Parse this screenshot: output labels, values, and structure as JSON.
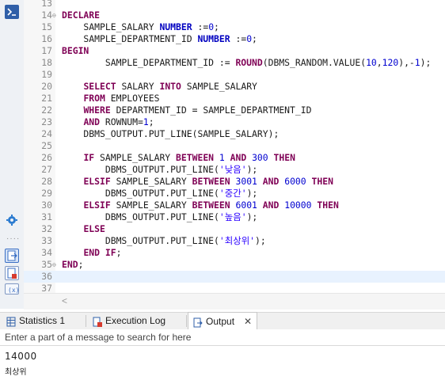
{
  "editor": {
    "lines": [
      {
        "n": "13",
        "code": ""
      },
      {
        "n": "14",
        "fold": "⊖",
        "code": "<span class='kw'>DECLARE</span>"
      },
      {
        "n": "15",
        "code": "    SAMPLE_SALARY <span class='ty'>NUMBER</span> :=<span class='num'>0</span>;"
      },
      {
        "n": "16",
        "code": "    SAMPLE_DEPARTMENT_ID <span class='ty'>NUMBER</span> :=<span class='num'>0</span>;"
      },
      {
        "n": "17",
        "code": "<span class='kw'>BEGIN</span>"
      },
      {
        "n": "18",
        "code": "        SAMPLE_DEPARTMENT_ID := <span class='fn'>ROUND</span>(DBMS_RANDOM.VALUE(<span class='num'>10</span>,<span class='num'>120</span>),-<span class='num'>1</span>);"
      },
      {
        "n": "19",
        "code": ""
      },
      {
        "n": "20",
        "code": "    <span class='kw'>SELECT</span> SALARY <span class='kw'>INTO</span> SAMPLE_SALARY"
      },
      {
        "n": "21",
        "code": "    <span class='kw'>FROM</span> EMPLOYEES"
      },
      {
        "n": "22",
        "code": "    <span class='kw'>WHERE</span> DEPARTMENT_ID = SAMPLE_DEPARTMENT_ID"
      },
      {
        "n": "23",
        "code": "    <span class='kw'>AND</span> ROWNUM=<span class='num'>1</span>;"
      },
      {
        "n": "24",
        "code": "    DBMS_OUTPUT.PUT_LINE(SAMPLE_SALARY);"
      },
      {
        "n": "25",
        "code": ""
      },
      {
        "n": "26",
        "code": "    <span class='kw'>IF</span> SAMPLE_SALARY <span class='kw'>BETWEEN</span> <span class='num'>1</span> <span class='kw'>AND</span> <span class='num'>300</span> <span class='kw'>THEN</span>"
      },
      {
        "n": "27",
        "code": "        DBMS_OUTPUT.PUT_LINE(<span class='str'>'낮음'</span>);"
      },
      {
        "n": "28",
        "code": "    <span class='kw'>ELSIF</span> SAMPLE_SALARY <span class='kw'>BETWEEN</span> <span class='num'>3001</span> <span class='kw'>AND</span> <span class='num'>6000</span> <span class='kw'>THEN</span>"
      },
      {
        "n": "29",
        "code": "        DBMS_OUTPUT.PUT_LINE(<span class='str'>'중간'</span>);"
      },
      {
        "n": "30",
        "code": "    <span class='kw'>ELSIF</span> SAMPLE_SALARY <span class='kw'>BETWEEN</span> <span class='num'>6001</span> <span class='kw'>AND</span> <span class='num'>10000</span> <span class='kw'>THEN</span>"
      },
      {
        "n": "31",
        "code": "        DBMS_OUTPUT.PUT_LINE(<span class='str'>'높음'</span>);"
      },
      {
        "n": "32",
        "code": "    <span class='kw'>ELSE</span>"
      },
      {
        "n": "33",
        "code": "        DBMS_OUTPUT.PUT_LINE(<span class='str'>'최상위'</span>);"
      },
      {
        "n": "34",
        "code": "    <span class='kw'>END IF</span>;"
      },
      {
        "n": "35",
        "fold": "⊖",
        "code": "<span class='kw'>END</span>;"
      },
      {
        "n": "36",
        "current": true,
        "code": ""
      },
      {
        "n": "37",
        "code": ""
      }
    ]
  },
  "tabs": [
    {
      "label": "Statistics 1",
      "icon": "statistics-grid-icon",
      "active": false
    },
    {
      "label": "Execution Log",
      "icon": "execution-log-icon",
      "active": false
    },
    {
      "label": "Output",
      "icon": "output-icon",
      "active": true,
      "close": "✕"
    }
  ],
  "output": {
    "search_placeholder": "Enter a part of a message to search for here",
    "lines": [
      "14000",
      "최상위"
    ]
  },
  "colors": {
    "keyword": "#7f0055",
    "type": "#0000c0",
    "number": "#0000d0",
    "string": "#2a00ff",
    "current_line": "#e8f2fe"
  }
}
